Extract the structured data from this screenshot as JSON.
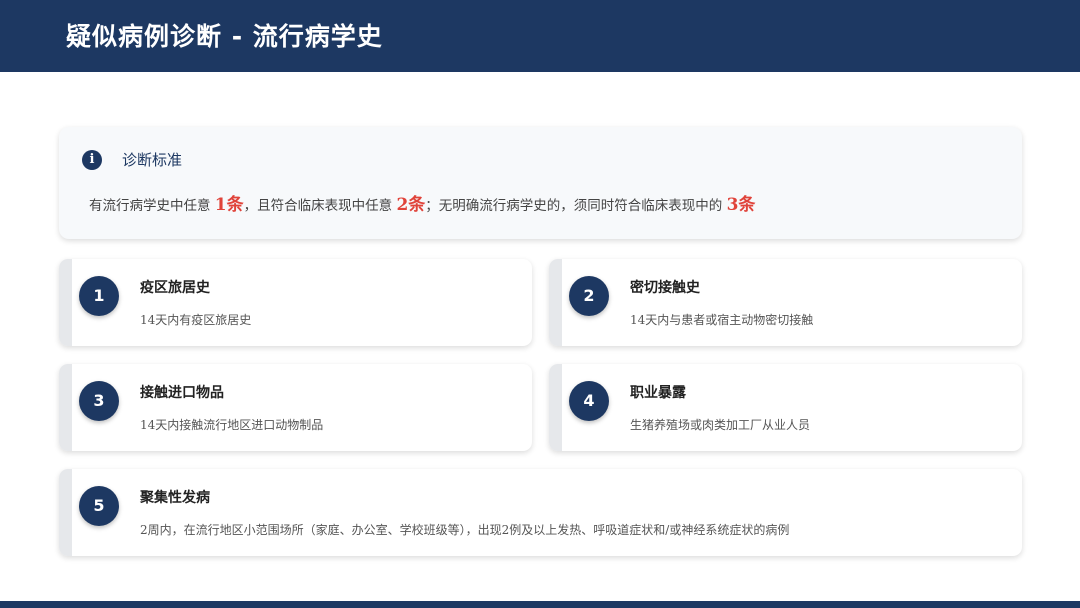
{
  "header": {
    "title": "疑似病例诊断 - 流行病学史"
  },
  "info": {
    "title": "诊断标准",
    "text_parts": [
      "有流行病学史中任意 ",
      "1条",
      "，且符合临床表现中任意 ",
      "2条",
      "；无明确流行病学史的，须同时符合临床表现中的 ",
      "3条"
    ]
  },
  "cards": [
    {
      "number": "1",
      "title": "疫区旅居史",
      "desc": "14天内有疫区旅居史"
    },
    {
      "number": "2",
      "title": "密切接触史",
      "desc": "14天内与患者或宿主动物密切接触"
    },
    {
      "number": "3",
      "title": "接触进口物品",
      "desc": "14天内接触流行地区进口动物制品"
    },
    {
      "number": "4",
      "title": "职业暴露",
      "desc": "生猪养殖场或肉类加工厂从业人员"
    },
    {
      "number": "5",
      "title": "聚集性发病",
      "desc": "2周内，在流行地区小范围场所（家庭、办公室、学校班级等），出现2例及以上发热、呼吸道症状和/或神经系统症状的病例"
    }
  ],
  "colors": {
    "primary": "#1d3862",
    "highlight": "#e0433a"
  }
}
